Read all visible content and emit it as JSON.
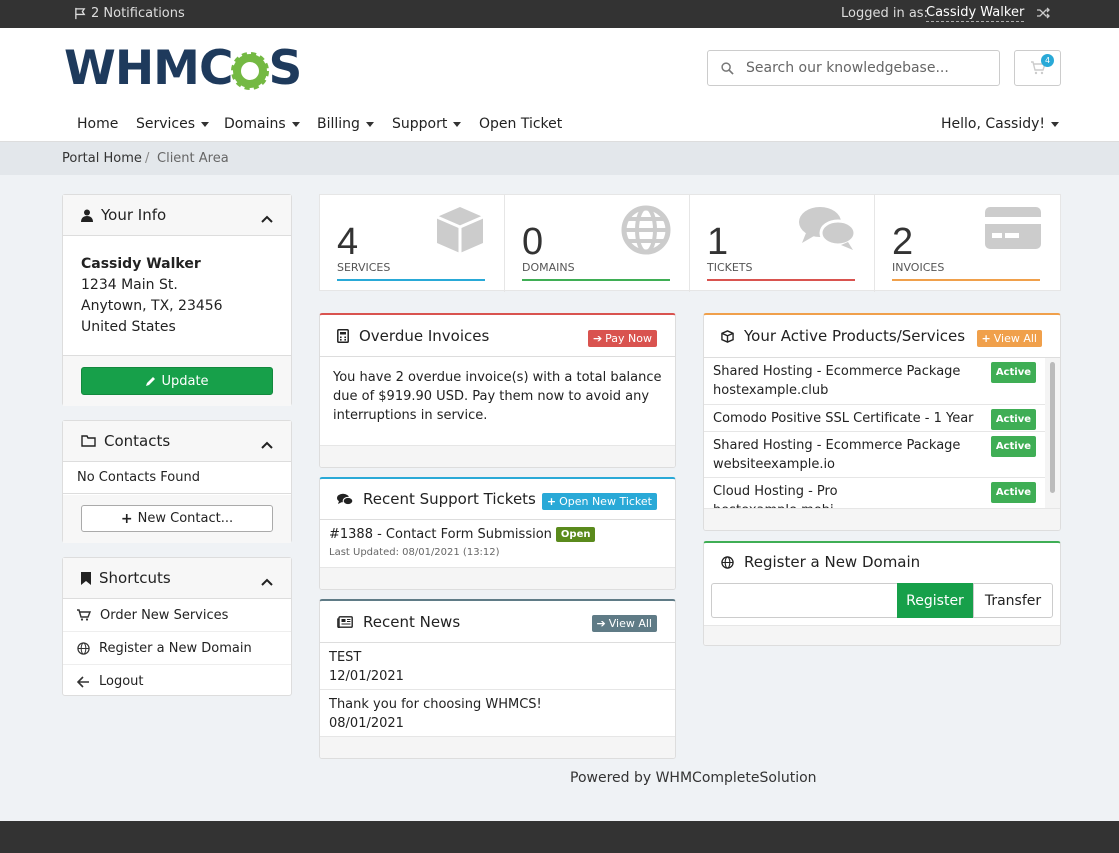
{
  "topbar": {
    "notifications": "2 Notifications",
    "logged_in_as": "Logged in as:",
    "user_name": "Cassidy Walker"
  },
  "header": {
    "logo_text_a": "WHM",
    "logo_text_b": "C",
    "logo_text_c": "S",
    "search_placeholder": "Search our knowledgebase...",
    "cart_count": "4"
  },
  "nav": {
    "home": "Home",
    "services": "Services",
    "domains": "Domains",
    "billing": "Billing",
    "support": "Support",
    "open_ticket": "Open Ticket",
    "hello": "Hello, Cassidy!"
  },
  "breadcrumb": {
    "portal_home": "Portal Home",
    "separator": "/",
    "current": "Client Area"
  },
  "your_info": {
    "title": "Your Info",
    "name": "Cassidy Walker",
    "address1": "1234 Main St.",
    "address2": "Anytown, TX, 23456",
    "country": "United States",
    "update_label": "Update"
  },
  "contacts": {
    "title": "Contacts",
    "empty": "No Contacts Found",
    "new_label": "New Contact..."
  },
  "shortcuts": {
    "title": "Shortcuts",
    "items": [
      "Order New Services",
      "Register a New Domain",
      "Logout"
    ]
  },
  "tiles": [
    {
      "count": "4",
      "label": "SERVICES",
      "color": "#29a9d7"
    },
    {
      "count": "0",
      "label": "DOMAINS",
      "color": "#3fae55"
    },
    {
      "count": "1",
      "label": "TICKETS",
      "color": "#d9534f"
    },
    {
      "count": "2",
      "label": "INVOICES",
      "color": "#f0a04b"
    }
  ],
  "overdue": {
    "title": "Overdue Invoices",
    "pay_now": "Pay Now",
    "message": "You have 2 overdue invoice(s) with a total balance due of $919.90 USD. Pay them now to avoid any interruptions in service."
  },
  "tickets": {
    "title": "Recent Support Tickets",
    "open_new": "Open New Ticket",
    "ticket_subject": "#1388 - Contact Form Submission",
    "ticket_status": "Open",
    "ticket_updated": "Last Updated: 08/01/2021 (13:12)"
  },
  "news": {
    "title": "Recent News",
    "view_all": "View All",
    "items": [
      {
        "title": "TEST",
        "date": "12/01/2021"
      },
      {
        "title": "Thank you for choosing WHMCS!",
        "date": "08/01/2021"
      }
    ]
  },
  "products": {
    "title": "Your Active Products/Services",
    "view_all": "View All",
    "items": [
      {
        "name": "Shared Hosting - Ecommerce Package",
        "domain": "hostexample.club",
        "status": "Active"
      },
      {
        "name": "Comodo Positive SSL Certificate - 1 Year",
        "domain": "",
        "status": "Active"
      },
      {
        "name": "Shared Hosting - Ecommerce Package",
        "domain": "websiteexample.io",
        "status": "Active"
      },
      {
        "name": "Cloud Hosting - Pro",
        "domain": "hostexample.mobi",
        "status": "Active"
      }
    ]
  },
  "register_domain": {
    "title": "Register a New Domain",
    "register": "Register",
    "transfer": "Transfer"
  },
  "footer": {
    "powered_by": "Powered by WHMCompleteSolution"
  },
  "colors": {
    "accent_green": "#17a04a",
    "red": "#d9534f",
    "blue": "#29a9d7",
    "orange": "#f0a04b",
    "dark": "#333333"
  }
}
